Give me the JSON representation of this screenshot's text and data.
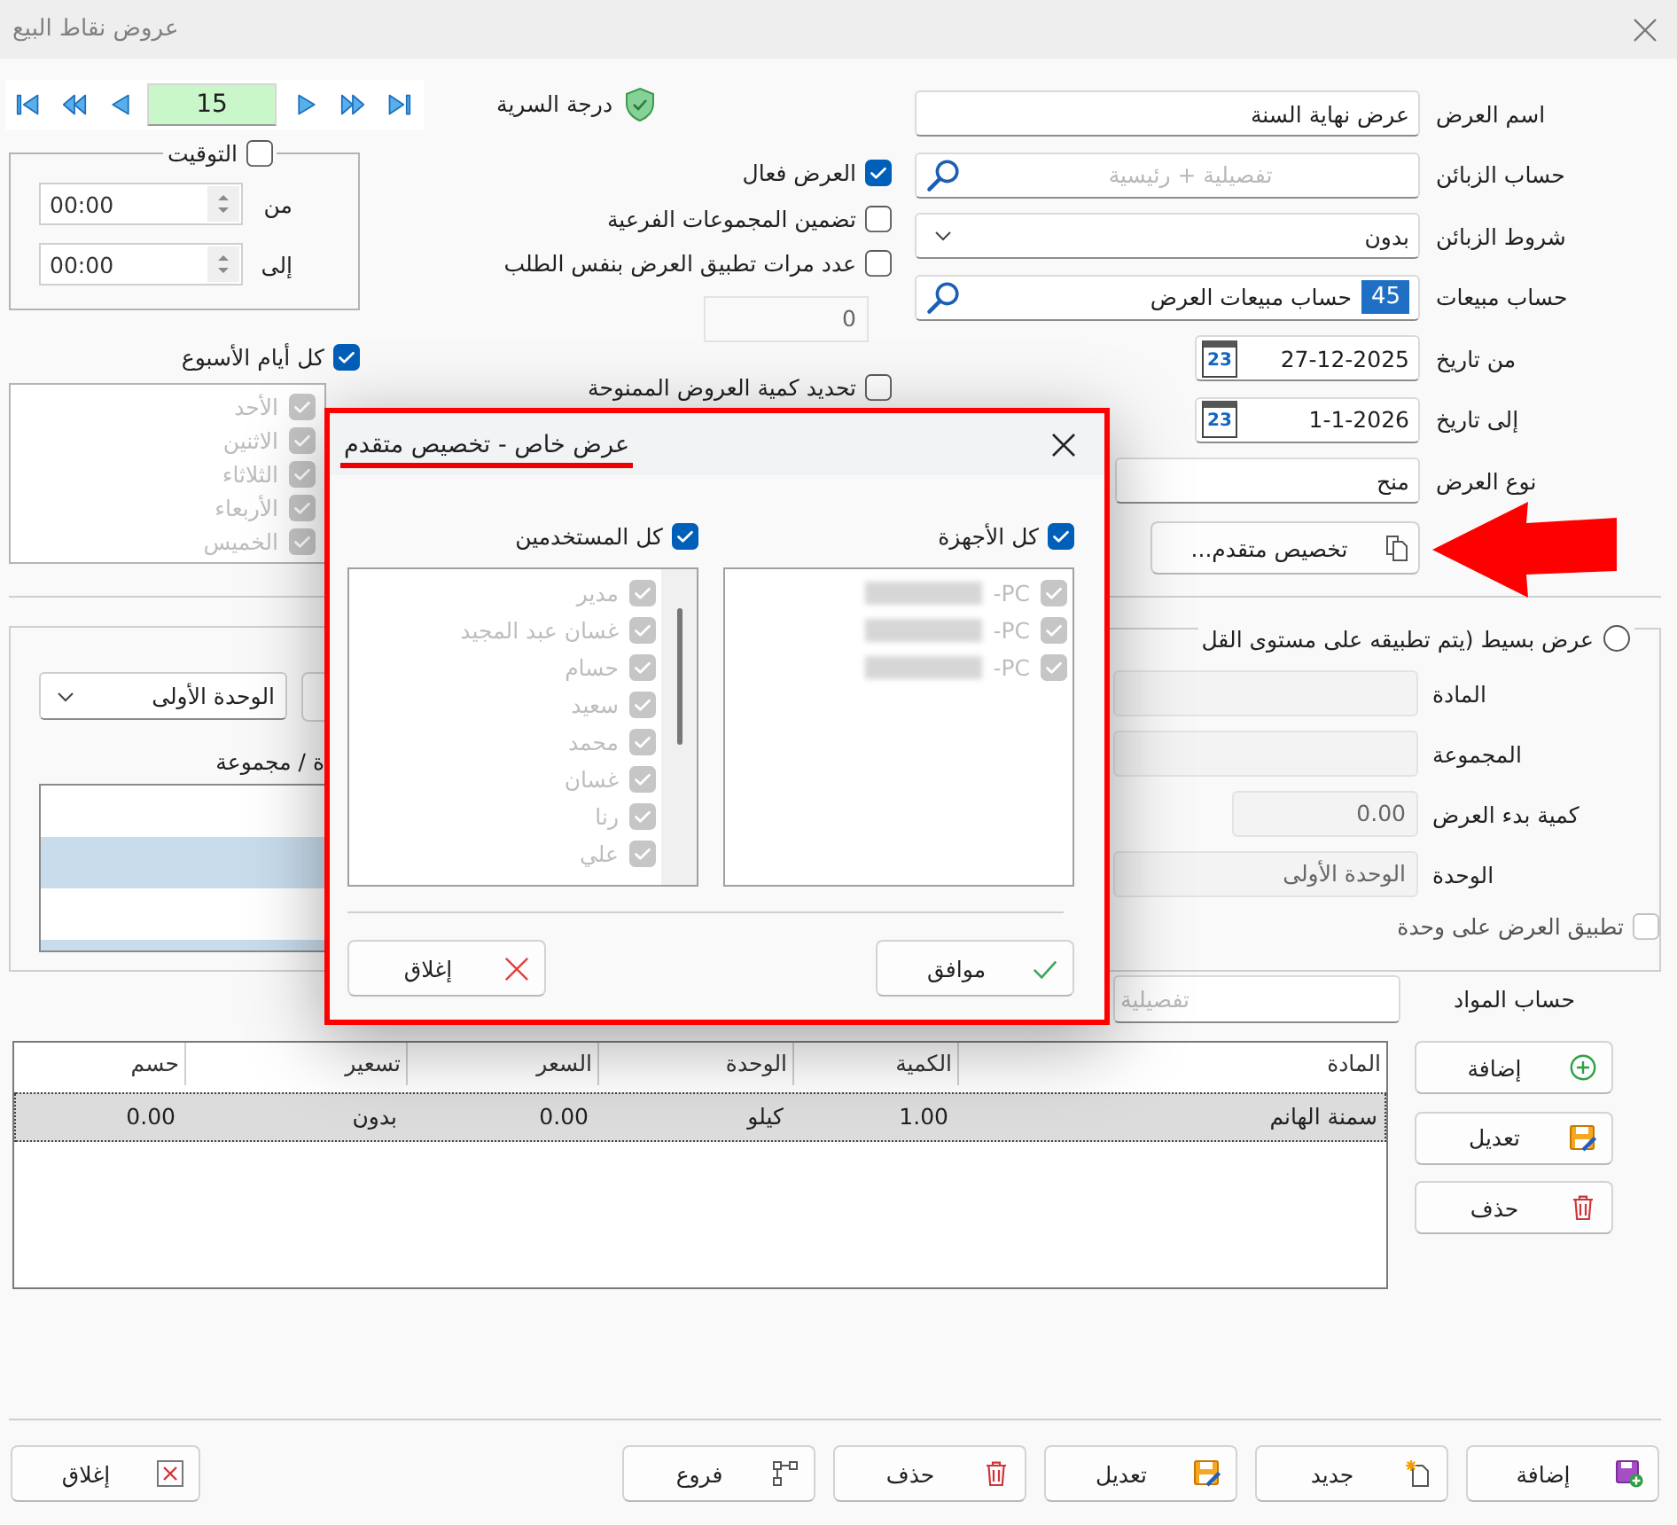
{
  "window": {
    "title": "عروض نقاط البيع"
  },
  "navigator": {
    "record": "15"
  },
  "security": {
    "label": "درجة السرية"
  },
  "timing": {
    "label": "التوقيت",
    "checked": false,
    "rows": [
      {
        "label": "من",
        "value": "00:00"
      },
      {
        "label": "إلى",
        "value": "00:00"
      }
    ]
  },
  "week_days": {
    "label": "كل أيام الأسبوع",
    "checked": true,
    "days": [
      {
        "label": "الأحد",
        "checked": true,
        "disabled": true
      },
      {
        "label": "الاثنين",
        "checked": true,
        "disabled": true
      },
      {
        "label": "الثلاثاء",
        "checked": true,
        "disabled": true
      },
      {
        "label": "الأربعاء",
        "checked": true,
        "disabled": true
      },
      {
        "label": "الخميس",
        "checked": true,
        "disabled": true
      }
    ]
  },
  "options": [
    {
      "label": "العرض فعال",
      "checked": true
    },
    {
      "label": "تضمين المجموعات الفرعية",
      "checked": false
    },
    {
      "label": "عدد مرات تطبيق العرض بنفس الطلب",
      "checked": false
    }
  ],
  "times": {
    "value": "0",
    "disabled": true
  },
  "limit_option": {
    "label": "تحديد كمية العروض الممنوحة",
    "checked": false
  },
  "form": [
    {
      "label": "اسم العرض",
      "kind": "text",
      "value": "عرض نهاية السنة"
    },
    {
      "label": "حساب الزبائن",
      "kind": "search",
      "placeholder": "تفصيلية + رئيسية"
    },
    {
      "label": "شروط الزبائن",
      "kind": "select",
      "value": "بدون"
    },
    {
      "label": "حساب مبيعات",
      "kind": "account",
      "code": "45",
      "value": "حساب مبيعات العرض"
    },
    {
      "label": "من تاريخ",
      "kind": "date",
      "value": "27-12-2025",
      "calendar_day": "23"
    },
    {
      "label": "إلى تاريخ",
      "kind": "date",
      "value": "1-1-2026",
      "calendar_day": "23"
    },
    {
      "label": "نوع العرض",
      "kind": "short",
      "value": "منح"
    }
  ],
  "advanced_button": {
    "label": "تخصيص متقدم..."
  },
  "unit_panel": {
    "unit": "الوحدة الأولى",
    "grid_header": "ة / مجموعة"
  },
  "simple_offer": {
    "label": "عرض بسيط (يتم تطبيقه على مستوى القل",
    "selected": false,
    "fields": [
      {
        "label": "المادة",
        "kind": "wide",
        "disabled": true
      },
      {
        "label": "المجموعة",
        "kind": "wide",
        "disabled": true
      },
      {
        "label": "كمية بدء العرض",
        "kind": "narrow",
        "value": "0.00",
        "disabled": true
      },
      {
        "label": "الوحدة",
        "kind": "wide",
        "value": "الوحدة الأولى",
        "disabled": true
      }
    ],
    "apply_unit": {
      "label": "تطبيق العرض على وحدة",
      "checked": false,
      "disabled": true
    }
  },
  "materials_account": {
    "label": "حساب المواد",
    "placeholder": "تفصيلية"
  },
  "table": {
    "columns": [
      "المادة",
      "الكمية",
      "الوحدة",
      "السعر",
      "تسعير",
      "حسم"
    ],
    "rows": [
      {
        "cells": [
          "سمنة الهانم",
          "1.00",
          "كيلو",
          "0.00",
          "بدون",
          "0.00"
        ],
        "selected": true
      }
    ]
  },
  "side_buttons": [
    {
      "label": "إضافة",
      "kind": "add"
    },
    {
      "label": "تعديل",
      "kind": "edit"
    },
    {
      "label": "حذف",
      "kind": "delete"
    }
  ],
  "footer_buttons": [
    {
      "label": "إضافة",
      "kind": "save"
    },
    {
      "label": "جديد",
      "kind": "new"
    },
    {
      "label": "تعديل",
      "kind": "edit"
    },
    {
      "label": "حذف",
      "kind": "delete"
    },
    {
      "label": "فروع",
      "kind": "branches"
    },
    {
      "label": "إغلاق",
      "kind": "close"
    }
  ],
  "dialog": {
    "title": "عرض خاص - تخصيص متقدم",
    "users": {
      "label": "كل المستخدمين",
      "checked": true,
      "items": [
        {
          "label": "مدير",
          "checked": true,
          "disabled": true
        },
        {
          "label": "غسان عبد المجيد",
          "checked": true,
          "disabled": true
        },
        {
          "label": "حسام",
          "checked": true,
          "disabled": true
        },
        {
          "label": "سعيد",
          "checked": true,
          "disabled": true
        },
        {
          "label": "محمد",
          "checked": true,
          "disabled": true
        },
        {
          "label": "غسان",
          "checked": true,
          "disabled": true
        },
        {
          "label": "رنا",
          "checked": true,
          "disabled": true
        },
        {
          "label": "علي",
          "checked": true,
          "disabled": true
        }
      ]
    },
    "devices": {
      "label": "كل الأجهزة",
      "checked": true,
      "items": [
        {
          "label": "-PC",
          "checked": true,
          "disabled": true
        },
        {
          "label": "-PC",
          "checked": true,
          "disabled": true
        },
        {
          "label": "-PC",
          "checked": true,
          "disabled": true
        }
      ]
    },
    "buttons": [
      {
        "label": "موافق",
        "kind": "ok"
      },
      {
        "label": "إغلاق",
        "kind": "close"
      }
    ]
  }
}
